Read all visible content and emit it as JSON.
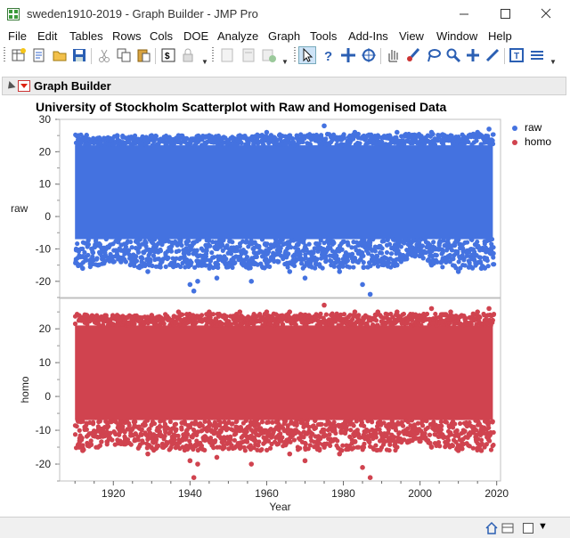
{
  "window": {
    "title": "sweden1910-2019 - Graph Builder - JMP Pro"
  },
  "menubar": [
    "File",
    "Edit",
    "Tables",
    "Rows",
    "Cols",
    "DOE",
    "Analyze",
    "Graph",
    "Tools",
    "Add-Ins",
    "View",
    "Window",
    "Help"
  ],
  "toolbar_icons": [
    "new-data-table-icon",
    "new-script-icon",
    "open-icon",
    "save-icon",
    "cut-icon",
    "copy-icon",
    "paste-icon",
    "script-icon",
    "lock-icon",
    "report-icon",
    "journal-icon",
    "add-icon",
    "arrow-tool-icon",
    "help-tool-icon",
    "selection-tool-icon",
    "crosshair-tool-icon",
    "hand-tool-icon",
    "brush-tool-icon",
    "lasso-tool-icon",
    "magnifier-tool-icon",
    "plus-tool-icon",
    "line-tool-icon",
    "annotate-tool-icon",
    "menu-lines-icon"
  ],
  "outline": {
    "title": "Graph Builder"
  },
  "colors": {
    "raw": "#4472e0",
    "homo": "#d0434f",
    "frame": "#c0c0c0"
  },
  "chart_data": {
    "type": "scatter",
    "title": "University of Stockholm Scatterplot with Raw and Homogenised Data",
    "xlabel": "Year",
    "xlim": [
      1906,
      2021
    ],
    "x_ticks": [
      1920,
      1940,
      1960,
      1980,
      2000,
      2020
    ],
    "panels": [
      {
        "name": "raw",
        "ylabel": "raw",
        "ylim": [
          -25,
          30
        ],
        "y_ticks": [
          30,
          20,
          10,
          0,
          -10,
          -20
        ],
        "band": {
          "x_start": 1910,
          "x_end": 2019,
          "lower": -7,
          "upper": 22
        },
        "peaks": [
          [
            1913,
            24
          ],
          [
            1921,
            25
          ],
          [
            1930,
            25
          ],
          [
            1937,
            25
          ],
          [
            1945,
            25
          ],
          [
            1953,
            25
          ],
          [
            1960,
            26
          ],
          [
            1966,
            25
          ],
          [
            1975,
            28
          ],
          [
            1983,
            26
          ],
          [
            1989,
            25
          ],
          [
            1994,
            26
          ],
          [
            2003,
            26
          ],
          [
            2008,
            25
          ],
          [
            2015,
            26
          ],
          [
            2018,
            27
          ]
        ],
        "troughs": [
          [
            1912,
            -16
          ],
          [
            1916,
            -15
          ],
          [
            1922,
            -14
          ],
          [
            1929,
            -17
          ],
          [
            1940,
            -21
          ],
          [
            1941,
            -23
          ],
          [
            1942,
            -20
          ],
          [
            1947,
            -19
          ],
          [
            1956,
            -20
          ],
          [
            1963,
            -14
          ],
          [
            1966,
            -17
          ],
          [
            1970,
            -19
          ],
          [
            1979,
            -17
          ],
          [
            1985,
            -21
          ],
          [
            1987,
            -24
          ],
          [
            1994,
            -15
          ],
          [
            1998,
            -12
          ],
          [
            2003,
            -15
          ],
          [
            2010,
            -17
          ],
          [
            2016,
            -16
          ]
        ]
      },
      {
        "name": "homo",
        "ylabel": "homo",
        "ylim": [
          -25,
          29
        ],
        "y_ticks": [
          20,
          10,
          0,
          -10,
          -20
        ],
        "band": {
          "x_start": 1910,
          "x_end": 2019,
          "lower": -7,
          "upper": 21
        },
        "peaks": [
          [
            1913,
            24
          ],
          [
            1921,
            24
          ],
          [
            1930,
            24
          ],
          [
            1937,
            25
          ],
          [
            1945,
            25
          ],
          [
            1953,
            25
          ],
          [
            1960,
            25
          ],
          [
            1966,
            25
          ],
          [
            1975,
            27
          ],
          [
            1983,
            25
          ],
          [
            1989,
            25
          ],
          [
            1994,
            25
          ],
          [
            2003,
            26
          ],
          [
            2008,
            25
          ],
          [
            2015,
            25
          ],
          [
            2018,
            26
          ]
        ],
        "troughs": [
          [
            1912,
            -16
          ],
          [
            1916,
            -15
          ],
          [
            1922,
            -14
          ],
          [
            1929,
            -17
          ],
          [
            1940,
            -19
          ],
          [
            1941,
            -24
          ],
          [
            1942,
            -20
          ],
          [
            1947,
            -18
          ],
          [
            1956,
            -20
          ],
          [
            1963,
            -14
          ],
          [
            1966,
            -17
          ],
          [
            1970,
            -19
          ],
          [
            1979,
            -17
          ],
          [
            1985,
            -21
          ],
          [
            1987,
            -24
          ],
          [
            1994,
            -15
          ],
          [
            1998,
            -13
          ],
          [
            2003,
            -15
          ],
          [
            2010,
            -16
          ],
          [
            2016,
            -16
          ]
        ]
      }
    ],
    "legend": {
      "placement": "right",
      "entries": [
        "raw",
        "homo"
      ]
    }
  }
}
